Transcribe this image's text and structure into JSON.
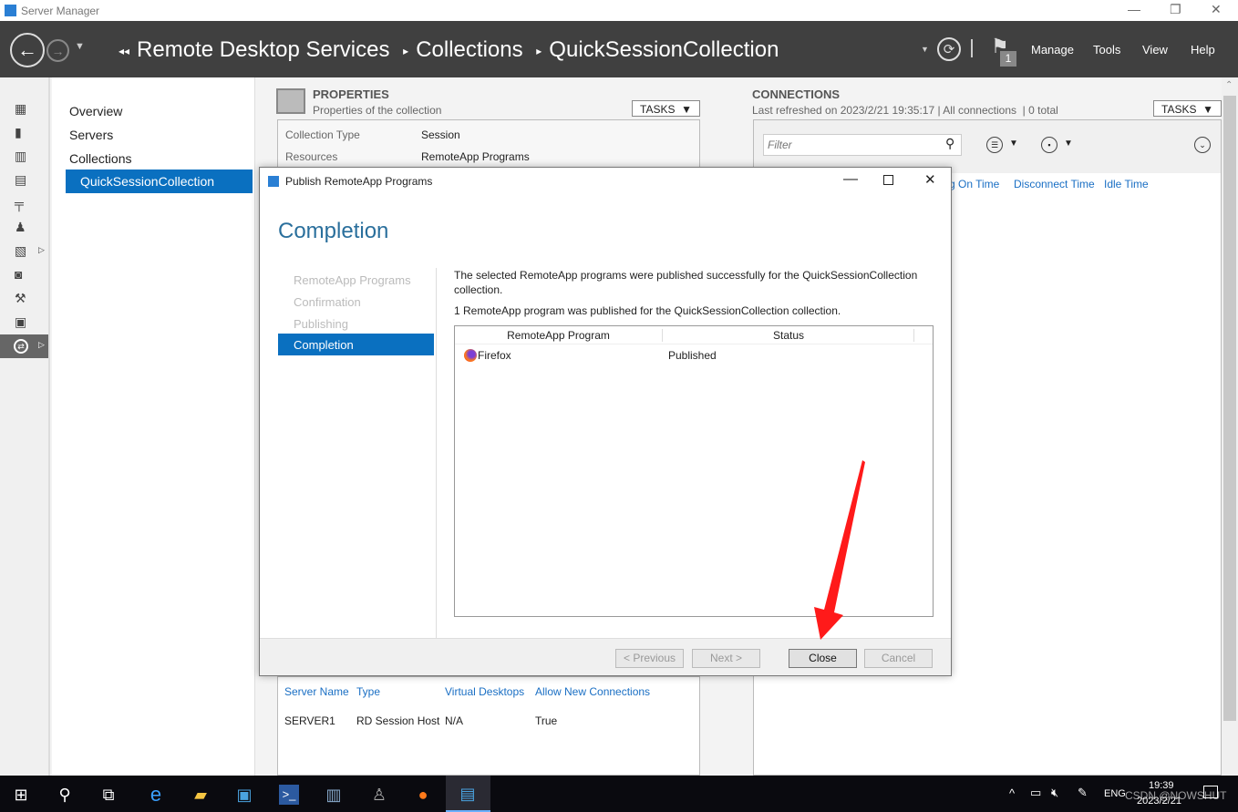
{
  "window": {
    "title": "Server Manager",
    "minimize": "—",
    "restore": "❐",
    "close": "✕"
  },
  "header": {
    "breadcrumb": [
      "Remote Desktop Services",
      "Collections",
      "QuickSessionCollection"
    ],
    "notification_count": "1",
    "menu": [
      "Manage",
      "Tools",
      "View",
      "Help"
    ]
  },
  "nav": {
    "items": [
      "Overview",
      "Servers",
      "Collections"
    ],
    "selected": "QuickSessionCollection"
  },
  "properties": {
    "title": "PROPERTIES",
    "subtitle": "Properties of the collection",
    "tasks": "TASKS",
    "rows": [
      {
        "label": "Collection Type",
        "value": "Session"
      },
      {
        "label": "Resources",
        "value": "RemoteApp Programs"
      }
    ]
  },
  "connections": {
    "title": "CONNECTIONS",
    "subtitle": "Last refreshed on 2023/2/21 19:35:17 | All connections  | 0 total",
    "tasks": "TASKS",
    "filter_placeholder": "Filter",
    "columns": [
      "g On Time",
      "Disconnect Time",
      "Idle Time"
    ]
  },
  "servers": {
    "columns": [
      "Server Name",
      "Type",
      "Virtual Desktops",
      "Allow New Connections"
    ],
    "rows": [
      [
        "SERVER1",
        "RD Session Host",
        "N/A",
        "True"
      ]
    ]
  },
  "dialog": {
    "title": "Publish RemoteApp Programs",
    "heading": "Completion",
    "steps": [
      "RemoteApp Programs",
      "Confirmation",
      "Publishing",
      "Completion"
    ],
    "active_step": "Completion",
    "message": "The selected RemoteApp programs were published successfully for the QuickSessionCollection collection.",
    "summary": "1 RemoteApp program was published for the QuickSessionCollection collection.",
    "columns": [
      "RemoteApp Program",
      "Status"
    ],
    "rows": [
      {
        "program": "Firefox",
        "status": "Published"
      }
    ],
    "buttons": {
      "previous": "< Previous",
      "next": "Next >",
      "close": "Close",
      "cancel": "Cancel"
    }
  },
  "taskbar": {
    "lang": "ENG",
    "time": "19:39",
    "date": "2023/2/21",
    "watermark": "CSDN @NOWSHUT"
  },
  "colors": {
    "accent": "#0a70c0",
    "header": "#404040",
    "annotation_arrow": "#ff1a1a"
  }
}
